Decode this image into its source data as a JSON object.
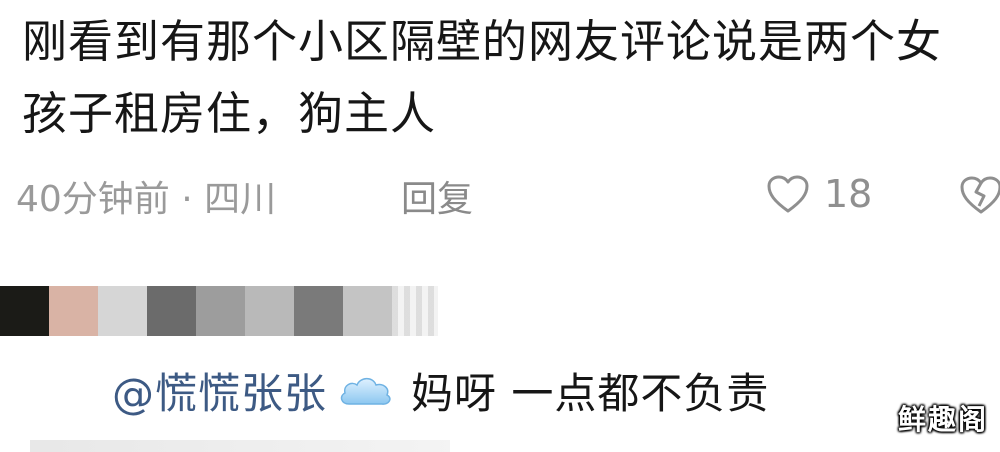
{
  "comment": {
    "text": "刚看到有那个小区隔壁的网友评论说是两个女孩子租房住，狗主人",
    "time_location": "40分钟前 · 四川",
    "reply_label": "回复",
    "like_count": "18",
    "icons": {
      "like": "heart-outline-icon",
      "dislike": "broken-heart-icon"
    }
  },
  "reply": {
    "mention": "@慌慌张张",
    "emoji": "cloud-emoji-icon",
    "text": "妈呀 一点都不负责"
  },
  "redacted_username_colors": [
    "#1b1b17",
    "#d9b3a5",
    "#d6d6d6",
    "#6b6b6b",
    "#9d9d9d",
    "#b9b9b9",
    "#7a7a7a",
    "#c4c4c4"
  ],
  "watermark": "鲜趣阁",
  "colors": {
    "mention": "#3d5a84",
    "meta": "#9a9a9a",
    "text": "#161616"
  }
}
